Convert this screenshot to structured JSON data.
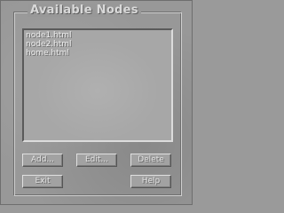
{
  "dialog": {
    "group_title": "Available Nodes",
    "nodes": [
      {
        "label": "node1.html"
      },
      {
        "label": "node2.html"
      },
      {
        "label": "home.html"
      }
    ],
    "buttons": {
      "add": "Add...",
      "edit": "Edit...",
      "delete": "Delete",
      "exit": "Exit",
      "help": "Help"
    }
  }
}
